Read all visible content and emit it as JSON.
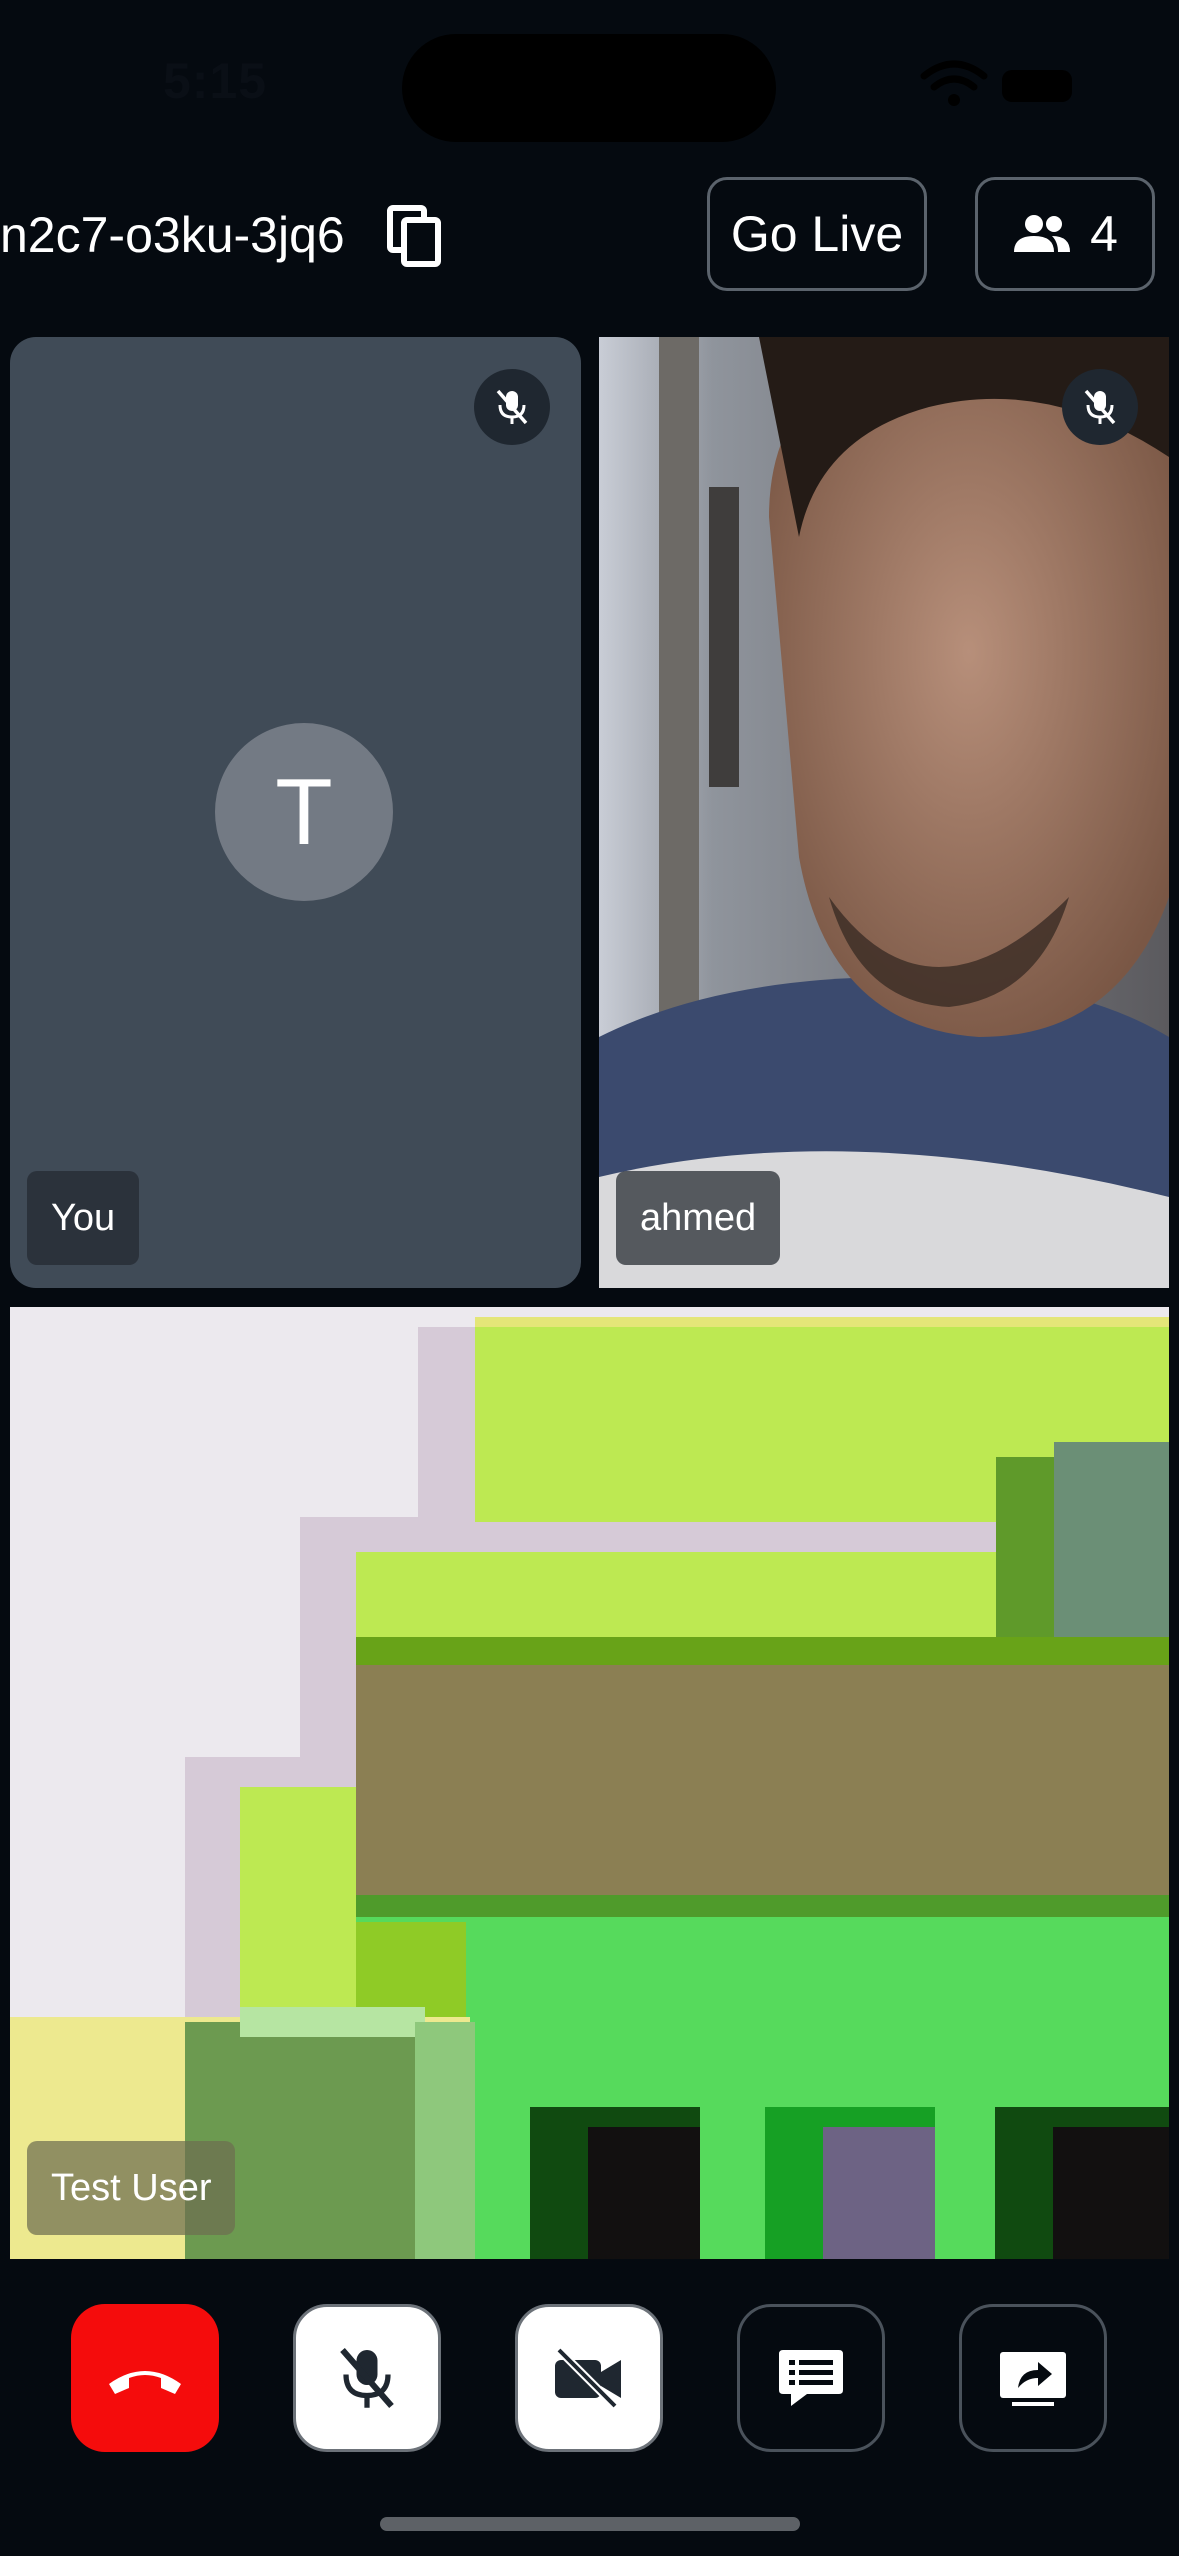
{
  "status_bar": {
    "time": "5:15"
  },
  "header": {
    "meeting_code": "n2c7-o3ku-3jq6",
    "copy_icon": "copy-icon",
    "go_live_label": "Go Live",
    "participant_count": "4",
    "participants_icon": "people-icon"
  },
  "tiles": [
    {
      "name": "You",
      "avatar_initial": "T",
      "muted": true
    },
    {
      "name": "ahmed",
      "muted": true
    },
    {
      "name": "Test User"
    }
  ],
  "controls": [
    {
      "id": "end-call",
      "icon": "phone-hangup-icon",
      "color": "#f50c0c"
    },
    {
      "id": "mic",
      "icon": "mic-off-icon"
    },
    {
      "id": "camera",
      "icon": "video-off-icon"
    },
    {
      "id": "chat",
      "icon": "chat-icon"
    },
    {
      "id": "share",
      "icon": "share-screen-icon"
    }
  ],
  "colors": {
    "background": "#050a10",
    "tile": "#404b57",
    "end_call": "#f50c0c"
  }
}
